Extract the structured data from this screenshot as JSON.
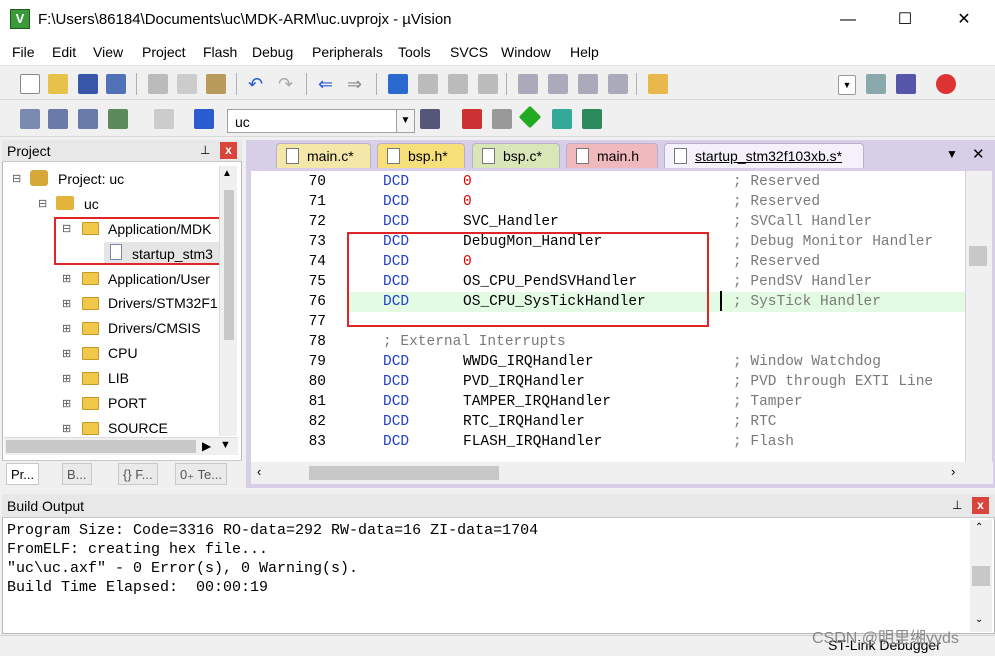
{
  "window": {
    "title": "F:\\Users\\86184\\Documents\\uc\\MDK-ARM\\uc.uvprojx - µVision",
    "minimize": "—",
    "maximize": "☐",
    "close": "✕"
  },
  "menu": [
    "File",
    "Edit",
    "View",
    "Project",
    "Flash",
    "Debug",
    "Peripherals",
    "Tools",
    "SVCS",
    "Window",
    "Help"
  ],
  "toolbar": {
    "target": "uc"
  },
  "project": {
    "title": "Project",
    "pin": "⊥",
    "close": "x",
    "tree": [
      {
        "label": "Project: uc"
      },
      {
        "label": "uc"
      },
      {
        "label": "Application/MDK"
      },
      {
        "label": "startup_stm3"
      },
      {
        "label": "Application/User"
      },
      {
        "label": "Drivers/STM32F1"
      },
      {
        "label": "Drivers/CMSIS"
      },
      {
        "label": "CPU"
      },
      {
        "label": "LIB"
      },
      {
        "label": "PORT"
      },
      {
        "label": "SOURCE"
      }
    ],
    "tabs": [
      "Pr...",
      "B...",
      "{} F...",
      "0₊ Te..."
    ]
  },
  "editor": {
    "tabs": [
      {
        "label": "main.c*",
        "color": "#f4e7a8"
      },
      {
        "label": "bsp.h*",
        "color": "#f7e07a"
      },
      {
        "label": "bsp.c*",
        "color": "#d9e6b8"
      },
      {
        "label": "main.h",
        "color": "#f0b9be"
      },
      {
        "label": "startup_stm32f103xb.s*",
        "color": "#f4f1fa"
      }
    ],
    "lines": [
      {
        "n": "70",
        "kw": "DCD",
        "arg": "0",
        "arg_num": true,
        "cmt": "; Reserved"
      },
      {
        "n": "71",
        "kw": "DCD",
        "arg": "0",
        "arg_num": true,
        "cmt": "; Reserved"
      },
      {
        "n": "72",
        "kw": "DCD",
        "arg": "SVC_Handler",
        "arg_num": false,
        "cmt": "; SVCall Handler"
      },
      {
        "n": "73",
        "kw": "DCD",
        "arg": "DebugMon_Handler",
        "arg_num": false,
        "cmt": "; Debug Monitor Handler"
      },
      {
        "n": "74",
        "kw": "DCD",
        "arg": "0",
        "arg_num": true,
        "cmt": "; Reserved"
      },
      {
        "n": "75",
        "kw": "DCD",
        "arg": "OS_CPU_PendSVHandler",
        "arg_num": false,
        "cmt": "; PendSV Handler"
      },
      {
        "n": "76",
        "kw": "DCD",
        "arg": "OS_CPU_SysTickHandler",
        "arg_num": false,
        "cmt": "; SysTick Handler"
      },
      {
        "n": "77",
        "kw": "",
        "arg": "",
        "arg_num": false,
        "cmt": ""
      },
      {
        "n": "78",
        "kw": "",
        "arg": "",
        "arg_num": false,
        "cmt": "; External Interrupts"
      },
      {
        "n": "79",
        "kw": "DCD",
        "arg": "WWDG_IRQHandler",
        "arg_num": false,
        "cmt": "; Window Watchdog"
      },
      {
        "n": "80",
        "kw": "DCD",
        "arg": "PVD_IRQHandler",
        "arg_num": false,
        "cmt": "; PVD through EXTI Line"
      },
      {
        "n": "81",
        "kw": "DCD",
        "arg": "TAMPER_IRQHandler",
        "arg_num": false,
        "cmt": "; Tamper"
      },
      {
        "n": "82",
        "kw": "DCD",
        "arg": "RTC_IRQHandler",
        "arg_num": false,
        "cmt": "; RTC"
      },
      {
        "n": "83",
        "kw": "DCD",
        "arg": "FLASH_IRQHandler",
        "arg_num": false,
        "cmt": "; Flash"
      }
    ]
  },
  "build": {
    "title": "Build Output",
    "lines": [
      "Program Size: Code=3316 RO-data=292 RW-data=16 ZI-data=1704",
      "FromELF: creating hex file...",
      "\"uc\\uc.axf\" - 0 Error(s), 0 Warning(s).",
      "Build Time Elapsed:  00:00:19"
    ]
  },
  "status": {
    "debugger": "ST-Link Debugger"
  },
  "watermark": "CSDN @明里缃yyds"
}
